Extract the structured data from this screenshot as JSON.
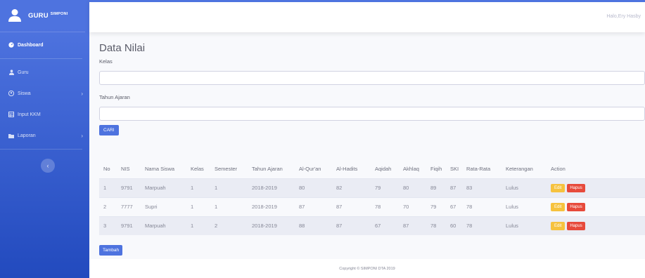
{
  "sidebar": {
    "brand": "GURU",
    "brand_sup": "SIMPONI",
    "items": [
      {
        "label": "Dashboard",
        "icon": "tachometer-icon"
      },
      {
        "label": "Guru",
        "icon": "user-icon"
      },
      {
        "label": "Siswa",
        "icon": "users-icon"
      },
      {
        "label": "Input KKM",
        "icon": "table-icon"
      },
      {
        "label": "Laporan",
        "icon": "folder-icon"
      }
    ]
  },
  "topbar": {
    "greeting": "Halo,Ery Hasby"
  },
  "main": {
    "title": "Data Nilai",
    "kelas_label": "Kelas",
    "tahun_label": "Tahun Ajaran",
    "cari_label": "CARI",
    "tambah_label": "Tambah"
  },
  "table": {
    "headers": [
      "No",
      "NIS",
      "Nama Siswa",
      "Kelas",
      "Semester",
      "Tahun Ajaran",
      "Al-Qur'an",
      "Al-Hadits",
      "Aqidah",
      "Akhlaq",
      "Fiqih",
      "SKI",
      "Rata-Rata",
      "Keterangan",
      "Action"
    ],
    "rows": [
      [
        "1",
        "9791",
        "Marpuah",
        "1",
        "1",
        "2018-2019",
        "80",
        "82",
        "79",
        "80",
        "89",
        "87",
        "83",
        "Lulus"
      ],
      [
        "2",
        "7777",
        "Supri",
        "1",
        "1",
        "2018-2019",
        "87",
        "87",
        "78",
        "70",
        "79",
        "67",
        "78",
        "Lulus"
      ],
      [
        "3",
        "9791",
        "Marpuah",
        "1",
        "2",
        "2018-2019",
        "88",
        "87",
        "67",
        "87",
        "78",
        "60",
        "78",
        "Lulus"
      ]
    ],
    "edit_label": "Edit",
    "hapus_label": "Hapus"
  },
  "footer": {
    "text": "Copyright © SIMPONI DTA 2019"
  },
  "colors": {
    "primary": "#4e73df",
    "warning": "#f6c23e",
    "danger": "#e74a3b"
  }
}
